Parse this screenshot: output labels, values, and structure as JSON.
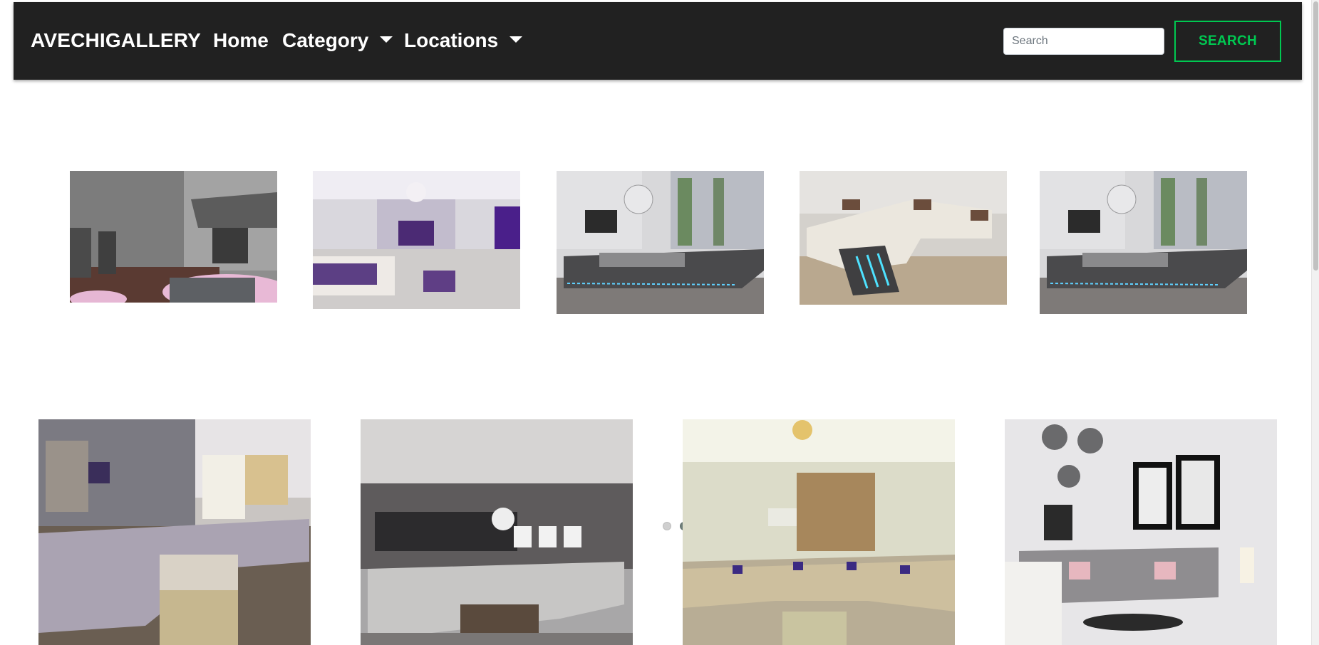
{
  "navbar": {
    "brand": "AVECHIGALLERY",
    "links": [
      {
        "label": "Home",
        "has_dropdown": false
      },
      {
        "label": "Category",
        "has_dropdown": true
      },
      {
        "label": "Locations",
        "has_dropdown": true
      }
    ],
    "search": {
      "placeholder": "Search",
      "value": "",
      "button_label": "SEARCH"
    },
    "colors": {
      "background": "#212121",
      "accent": "#00c851"
    }
  },
  "carousel": {
    "slides": [
      "old-building-balcony-image",
      "white-bedroom-purple-accents-image",
      "modern-bed-led-image",
      "white-sectional-sofa-led-image",
      "modern-bed-led-image"
    ],
    "indicator_count": 8,
    "active_indicator": 2
  },
  "gallery": {
    "items": [
      "purple-tufted-sectional-living-room-image",
      "grey-sectional-living-room-image",
      "arabic-majlis-living-room-image",
      "grey-sofa-living-room-image"
    ]
  }
}
